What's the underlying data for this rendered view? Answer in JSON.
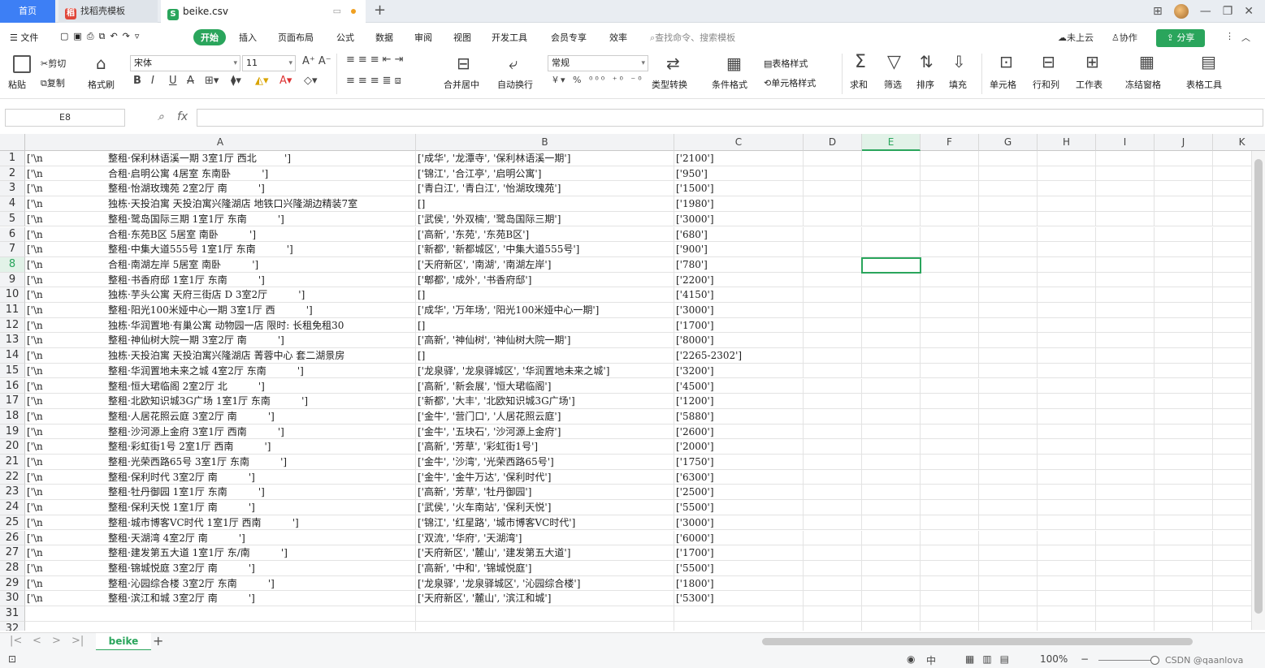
{
  "tabs": {
    "home": "首页",
    "template": "找稻壳模板",
    "file": "beike.csv"
  },
  "menu": {
    "file": "文件",
    "start": "开始",
    "insert": "插入",
    "layout": "页面布局",
    "formula": "公式",
    "data": "数据",
    "review": "审阅",
    "view": "视图",
    "dev": "开发工具",
    "member": "会员专享",
    "efficiency": "效率",
    "search": "查找命令、搜索模板",
    "cloud": "未上云",
    "collab": "协作",
    "share": "分享"
  },
  "ribbon": {
    "paste": "粘贴",
    "cut": "剪切",
    "copy": "复制",
    "format_painter": "格式刷",
    "font": "宋体",
    "font_size": "11",
    "merge_center": "合并居中",
    "wrap": "自动换行",
    "number_format": "常规",
    "type_convert": "类型转换",
    "cond_format": "条件格式",
    "table_style": "表格样式",
    "cell_style": "单元格样式",
    "sum": "求和",
    "filter": "筛选",
    "sort": "排序",
    "fill": "填充",
    "cell": "单元格",
    "row_col": "行和列",
    "worksheet": "工作表",
    "freeze": "冻结窗格",
    "table_tools": "表格工具"
  },
  "formula_bar": {
    "name_box": "E8",
    "fx": "fx",
    "value": ""
  },
  "columns": [
    "A",
    "B",
    "C",
    "D",
    "E",
    "F",
    "G",
    "H",
    "I",
    "J",
    "K"
  ],
  "selected_col": "E",
  "selected_row": 8,
  "rows": [
    {
      "n": "1",
      "a_pre": "['\\n",
      "a": "整租·保利林语溪一期 3室1厅 西北         ']",
      "b": "['成华', '龙潭寺', '保利林语溪一期']",
      "c": "['2100']"
    },
    {
      "n": "2",
      "a_pre": "['\\n",
      "a": "合租·启明公寓 4居室 东南卧          ']",
      "b": "['锦江', '合江亭', '启明公寓']",
      "c": "['950']"
    },
    {
      "n": "3",
      "a_pre": "['\\n",
      "a": "整租·怡湖玫瑰苑 2室2厅 南          ']",
      "b": "['青白江', '青白江', '怡湖玫瑰苑']",
      "c": "['1500']"
    },
    {
      "n": "4",
      "a_pre": "['\\n",
      "a": "独栋·天投泊寓 天投泊寓兴隆湖店 地铁口兴隆湖边精装7室",
      "b": "[]",
      "c": "['1980']"
    },
    {
      "n": "5",
      "a_pre": "['\\n",
      "a": "整租·鹭岛国际三期 1室1厅 东南          ']",
      "b": "['武侯', '外双楠', '鹭岛国际三期']",
      "c": "['3000']"
    },
    {
      "n": "6",
      "a_pre": "['\\n",
      "a": "合租·东苑B区 5居室 南卧          ']",
      "b": "['高新', '东苑', '东苑B区']",
      "c": "['680']"
    },
    {
      "n": "7",
      "a_pre": "['\\n",
      "a": "整租·中集大道555号 1室1厅 东南          ']",
      "b": "['新都', '新都城区', '中集大道555号']",
      "c": "['900']"
    },
    {
      "n": "8",
      "a_pre": "['\\n",
      "a": "合租·南湖左岸 5居室 南卧          ']",
      "b": "['天府新区', '南湖', '南湖左岸']",
      "c": "['780']"
    },
    {
      "n": "9",
      "a_pre": "['\\n",
      "a": "整租·书香府邸 1室1厅 东南          ']",
      "b": "['郫都', '成外', '书香府邸']",
      "c": "['2200']"
    },
    {
      "n": "10",
      "a_pre": "['\\n",
      "a": "独栋·芋头公寓 天府三街店 D 3室2厅          ']",
      "b": "[]",
      "c": "['4150']"
    },
    {
      "n": "11",
      "a_pre": "['\\n",
      "a": "整租·阳光100米娅中心一期 3室1厅 西          ']",
      "b": "['成华', '万年场', '阳光100米娅中心一期']",
      "c": "['3000']"
    },
    {
      "n": "12",
      "a_pre": "['\\n",
      "a": "独栋·华润置地·有巢公寓 动物园一店 限时: 长租免租30",
      "b": "[]",
      "c": "['1700']"
    },
    {
      "n": "13",
      "a_pre": "['\\n",
      "a": "整租·神仙树大院一期 3室2厅 南          ']",
      "b": "['高新', '神仙树', '神仙树大院一期']",
      "c": "['8000']"
    },
    {
      "n": "14",
      "a_pre": "['\\n",
      "a": "独栋·天投泊寓 天投泊寓兴隆湖店 菁蓉中心 套二湖景房",
      "b": "[]",
      "c": "['2265-2302']"
    },
    {
      "n": "15",
      "a_pre": "['\\n",
      "a": "整租·华润置地未来之城 4室2厅 东南          ']",
      "b": "['龙泉驿', '龙泉驿城区', '华润置地未来之城']",
      "c": "['3200']"
    },
    {
      "n": "16",
      "a_pre": "['\\n",
      "a": "整租·恒大珺临阁 2室2厅 北          ']",
      "b": "['高新', '新会展', '恒大珺临阁']",
      "c": "['4500']"
    },
    {
      "n": "17",
      "a_pre": "['\\n",
      "a": "整租·北欧知识城3G广场 1室1厅 东南          ']",
      "b": "['新都', '大丰', '北欧知识城3G广场']",
      "c": "['1200']"
    },
    {
      "n": "18",
      "a_pre": "['\\n",
      "a": "整租·人居花照云庭 3室2厅 南          ']",
      "b": "['金牛', '营门口', '人居花照云庭']",
      "c": "['5880']"
    },
    {
      "n": "19",
      "a_pre": "['\\n",
      "a": "整租·沙河源上金府 3室1厅 西南          ']",
      "b": "['金牛', '五块石', '沙河源上金府']",
      "c": "['2600']"
    },
    {
      "n": "20",
      "a_pre": "['\\n",
      "a": "整租·彩虹街1号 2室1厅 西南          ']",
      "b": "['高新', '芳草', '彩虹街1号']",
      "c": "['2000']"
    },
    {
      "n": "21",
      "a_pre": "['\\n",
      "a": "整租·光荣西路65号 3室1厅 东南          ']",
      "b": "['金牛', '沙湾', '光荣西路65号']",
      "c": "['1750']"
    },
    {
      "n": "22",
      "a_pre": "['\\n",
      "a": "整租·保利时代 3室2厅 南          ']",
      "b": "['金牛', '金牛万达', '保利时代']",
      "c": "['6300']"
    },
    {
      "n": "23",
      "a_pre": "['\\n",
      "a": "整租·牡丹御园 1室1厅 东南          ']",
      "b": "['高新', '芳草', '牡丹御园']",
      "c": "['2500']"
    },
    {
      "n": "24",
      "a_pre": "['\\n",
      "a": "整租·保利天悦 1室1厅 南          ']",
      "b": "['武侯', '火车南站', '保利天悦']",
      "c": "['5500']"
    },
    {
      "n": "25",
      "a_pre": "['\\n",
      "a": "整租·城市博客VC时代 1室1厅 西南          ']",
      "b": "['锦江', '红星路', '城市博客VC时代']",
      "c": "['3000']"
    },
    {
      "n": "26",
      "a_pre": "['\\n",
      "a": "整租·天湖湾 4室2厅 南          ']",
      "b": "['双流', '华府', '天湖湾']",
      "c": "['6000']"
    },
    {
      "n": "27",
      "a_pre": "['\\n",
      "a": "整租·建发第五大道 1室1厅 东/南          ']",
      "b": "['天府新区', '麓山', '建发第五大道']",
      "c": "['1700']"
    },
    {
      "n": "28",
      "a_pre": "['\\n",
      "a": "整租·锦城悦庭 3室2厅 南          ']",
      "b": "['高新', '中和', '锦城悦庭']",
      "c": "['5500']"
    },
    {
      "n": "29",
      "a_pre": "['\\n",
      "a": "整租·沁园综合楼 3室2厅 东南          ']",
      "b": "['龙泉驿', '龙泉驿城区', '沁园综合楼']",
      "c": "['1800']"
    },
    {
      "n": "30",
      "a_pre": "['\\n",
      "a": "整租·滨江和城 3室2厅 南          ']",
      "b": "['天府新区', '麓山', '滨江和城']",
      "c": "['5300']"
    },
    {
      "n": "31",
      "a_pre": "",
      "a": "",
      "b": "",
      "c": ""
    },
    {
      "n": "32",
      "a_pre": "",
      "a": "",
      "b": "",
      "c": ""
    }
  ],
  "sheet_tab": "beike",
  "status": {
    "zoom": "100%",
    "input_mode": "中",
    "watermark": "CSDN @qaanlova"
  },
  "colors": {
    "accent": "#2aa55c",
    "home_tab": "#3d7ff5"
  }
}
